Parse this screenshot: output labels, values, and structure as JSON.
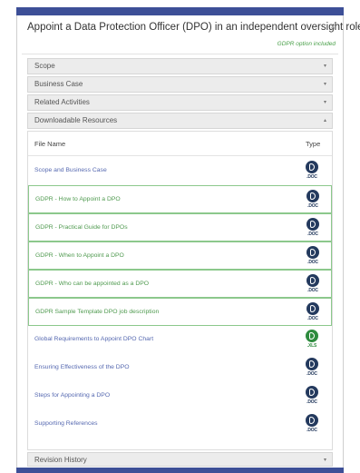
{
  "dialog": {
    "title": "Appoint a Data Protection Officer (DPO) in an independent oversight role",
    "close_symbol": "×",
    "note": "GDPR option included"
  },
  "sections": [
    {
      "label": "Scope",
      "chevron": "▾"
    },
    {
      "label": "Business Case",
      "chevron": "▾"
    },
    {
      "label": "Related Activities",
      "chevron": "▾"
    },
    {
      "label": "Downloadable Resources",
      "chevron": "▴"
    }
  ],
  "table": {
    "col_name": "File Name",
    "col_type": "Type",
    "rows": [
      {
        "name": "Scope and Business Case",
        "ext": ".DOC",
        "icon": "doc-file-icon",
        "highlight": false
      },
      {
        "name": "GDPR - How to Appoint a DPO",
        "ext": ".DOC",
        "icon": "doc-file-icon",
        "highlight": true
      },
      {
        "name": "GDPR - Practical Guide for DPOs",
        "ext": ".DOC",
        "icon": "doc-file-icon",
        "highlight": true
      },
      {
        "name": "GDPR - When to Appoint a DPO",
        "ext": ".DOC",
        "icon": "doc-file-icon",
        "highlight": true
      },
      {
        "name": "GDPR - Who can be appointed as a DPO",
        "ext": ".DOC",
        "icon": "doc-file-icon",
        "highlight": true
      },
      {
        "name": "GDPR Sample Template DPO job description",
        "ext": ".DOC",
        "icon": "doc-file-icon",
        "highlight": true
      },
      {
        "name": "Global Requirements to Appoint DPO Chart",
        "ext": ".XLS",
        "icon": "xls-file-icon",
        "highlight": false
      },
      {
        "name": "Ensuring Effectiveness of the DPO",
        "ext": ".DOC",
        "icon": "doc-file-icon",
        "highlight": false
      },
      {
        "name": "Steps for Appointing a DPO",
        "ext": ".DOC",
        "icon": "doc-file-icon",
        "highlight": false
      },
      {
        "name": "Supporting References",
        "ext": ".DOC",
        "icon": "doc-file-icon",
        "highlight": false
      }
    ]
  },
  "revision": {
    "label": "Revision History",
    "chevron": "▾"
  },
  "colors": {
    "bar": "#3d4f97",
    "link": "#5568b0",
    "gdpr_green": "#4f9a4f",
    "doc_icon": "#243a5e",
    "xls_icon": "#2e8b3e"
  }
}
